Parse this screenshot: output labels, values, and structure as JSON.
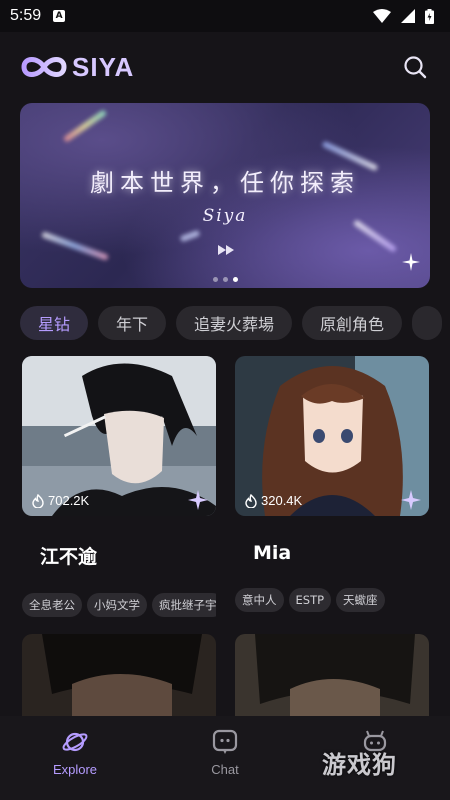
{
  "status_bar": {
    "time": "5:59",
    "notification_glyph": "A"
  },
  "header": {
    "app_name": "SIYA",
    "logo_icon": "siya-infinity-logo",
    "search_icon": "search-icon"
  },
  "banner": {
    "title": "劇本世界，任你探索",
    "subtitle": "Siya",
    "indicator": {
      "count": 3,
      "active_index": 2
    }
  },
  "tags": [
    {
      "label": "星钻",
      "active": true
    },
    {
      "label": "年下",
      "active": false
    },
    {
      "label": "追妻火葬場",
      "active": false
    },
    {
      "label": "原創角色",
      "active": false
    }
  ],
  "cards": [
    {
      "name": "江不逾",
      "count": "702.2K",
      "chips": [
        "全息老公",
        "小妈文学",
        "疯批继子宇"
      ]
    },
    {
      "name": "Mia",
      "count": "320.4K",
      "chips": [
        "意中人",
        "ESTP",
        "天蠍座"
      ]
    }
  ],
  "bottom_nav": [
    {
      "label": "Explore",
      "icon": "planet-icon",
      "active": true
    },
    {
      "label": "Chat",
      "icon": "chat-bubble-icon",
      "active": false
    },
    {
      "label": "",
      "icon": "robot-icon",
      "active": false
    }
  ],
  "watermark": {
    "text": "游戏狗"
  },
  "colors": {
    "accent": "#b59cff",
    "background": "#161418",
    "tag_bg": "#2a282d"
  }
}
